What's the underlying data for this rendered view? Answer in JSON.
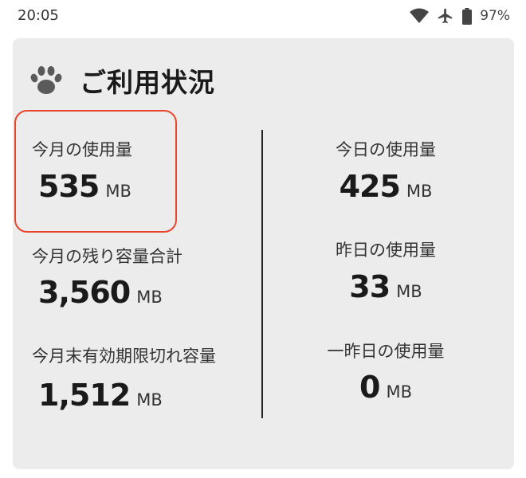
{
  "status_bar": {
    "time": "20:05",
    "battery_percent": "97%"
  },
  "card": {
    "title": "ご利用状況",
    "icon": "paw-icon",
    "highlight_color": "#e8452c",
    "left": [
      {
        "label": "今月の使用量",
        "value": "535",
        "unit": "MB"
      },
      {
        "label": "今月の残り容量合計",
        "value": "3,560",
        "unit": "MB"
      },
      {
        "label": "今月末有効期限切れ容量",
        "value": "1,512",
        "unit": "MB"
      }
    ],
    "right": [
      {
        "label": "今日の使用量",
        "value": "425",
        "unit": "MB"
      },
      {
        "label": "昨日の使用量",
        "value": "33",
        "unit": "MB"
      },
      {
        "label": "一昨日の使用量",
        "value": "0",
        "unit": "MB"
      }
    ]
  }
}
